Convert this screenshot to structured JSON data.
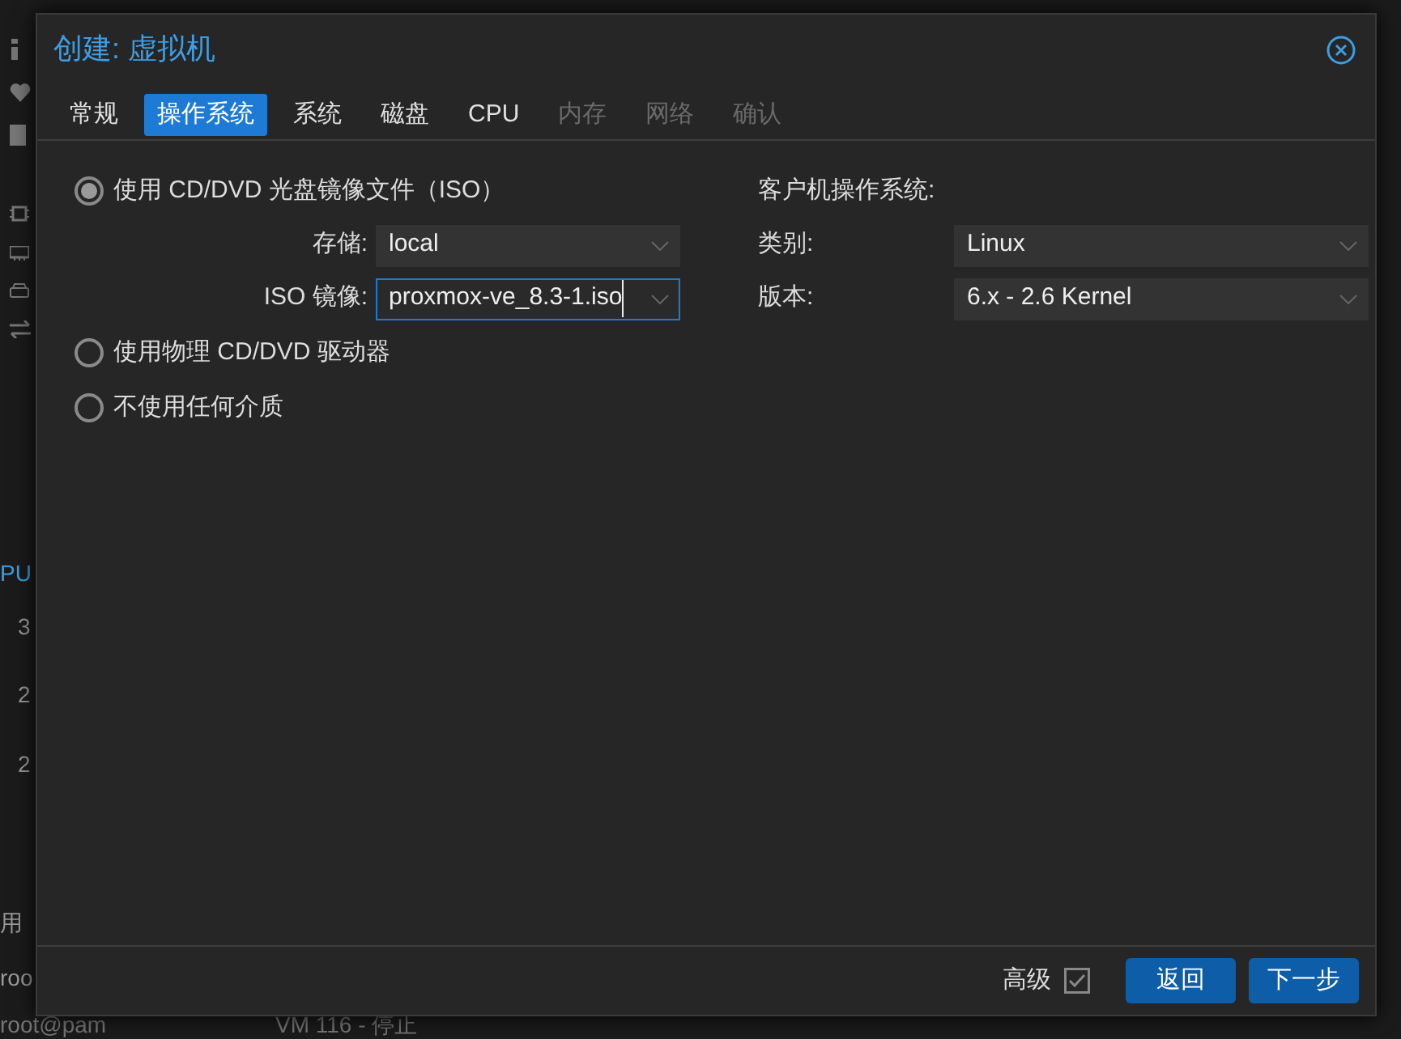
{
  "background": {
    "side_texts": [
      "PU",
      "3",
      "2",
      "2",
      "用",
      "roo"
    ],
    "bottom_texts": [
      "root@pam",
      "VM 116 - 停止"
    ]
  },
  "dialog": {
    "title": "创建: 虚拟机",
    "tabs": [
      {
        "label": "常规",
        "selected": false,
        "disabled": false
      },
      {
        "label": "操作系统",
        "selected": true,
        "disabled": false
      },
      {
        "label": "系统",
        "selected": false,
        "disabled": false
      },
      {
        "label": "磁盘",
        "selected": false,
        "disabled": false
      },
      {
        "label": "CPU",
        "selected": false,
        "disabled": false
      },
      {
        "label": "内存",
        "selected": false,
        "disabled": true
      },
      {
        "label": "网络",
        "selected": false,
        "disabled": true
      },
      {
        "label": "确认",
        "selected": false,
        "disabled": true
      }
    ],
    "media_options": [
      {
        "label": "使用 CD/DVD 光盘镜像文件（ISO）",
        "selected": true,
        "fields": [
          {
            "label": "存储:",
            "value": "local",
            "focused": false
          },
          {
            "label": "ISO 镜像:",
            "value": "proxmox-ve_8.3-1.iso",
            "focused": true
          }
        ]
      },
      {
        "label": "使用物理 CD/DVD 驱动器",
        "selected": false
      },
      {
        "label": "不使用任何介质",
        "selected": false
      }
    ],
    "guest_os": {
      "heading": "客户机操作系统:",
      "fields": [
        {
          "label": "类别:",
          "value": "Linux"
        },
        {
          "label": "版本:",
          "value": "6.x - 2.6 Kernel"
        }
      ]
    },
    "footer": {
      "advanced_label": "高级",
      "advanced_checked": true,
      "buttons": [
        "返回",
        "下一步"
      ]
    }
  }
}
